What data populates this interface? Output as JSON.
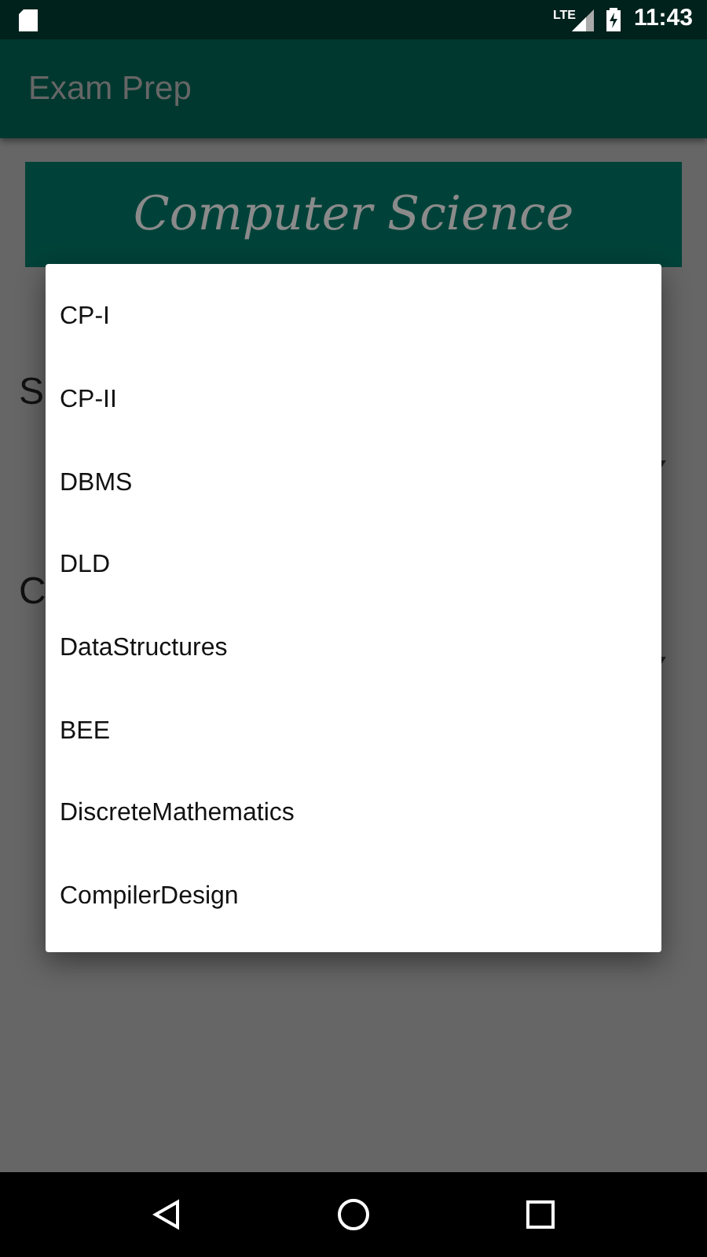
{
  "status_bar": {
    "network": "LTE",
    "time": "11:43"
  },
  "app_bar": {
    "title": "Exam Prep"
  },
  "banner": {
    "title": "Computer Science"
  },
  "background_labels": [
    {
      "text": "S"
    },
    {
      "text": "C"
    }
  ],
  "dropdown": {
    "items": [
      {
        "label": "CP-I"
      },
      {
        "label": "CP-II"
      },
      {
        "label": "DBMS"
      },
      {
        "label": "DLD"
      },
      {
        "label": "DataStructures"
      },
      {
        "label": "BEE"
      },
      {
        "label": "DiscreteMathematics"
      },
      {
        "label": "CompilerDesign"
      }
    ]
  }
}
